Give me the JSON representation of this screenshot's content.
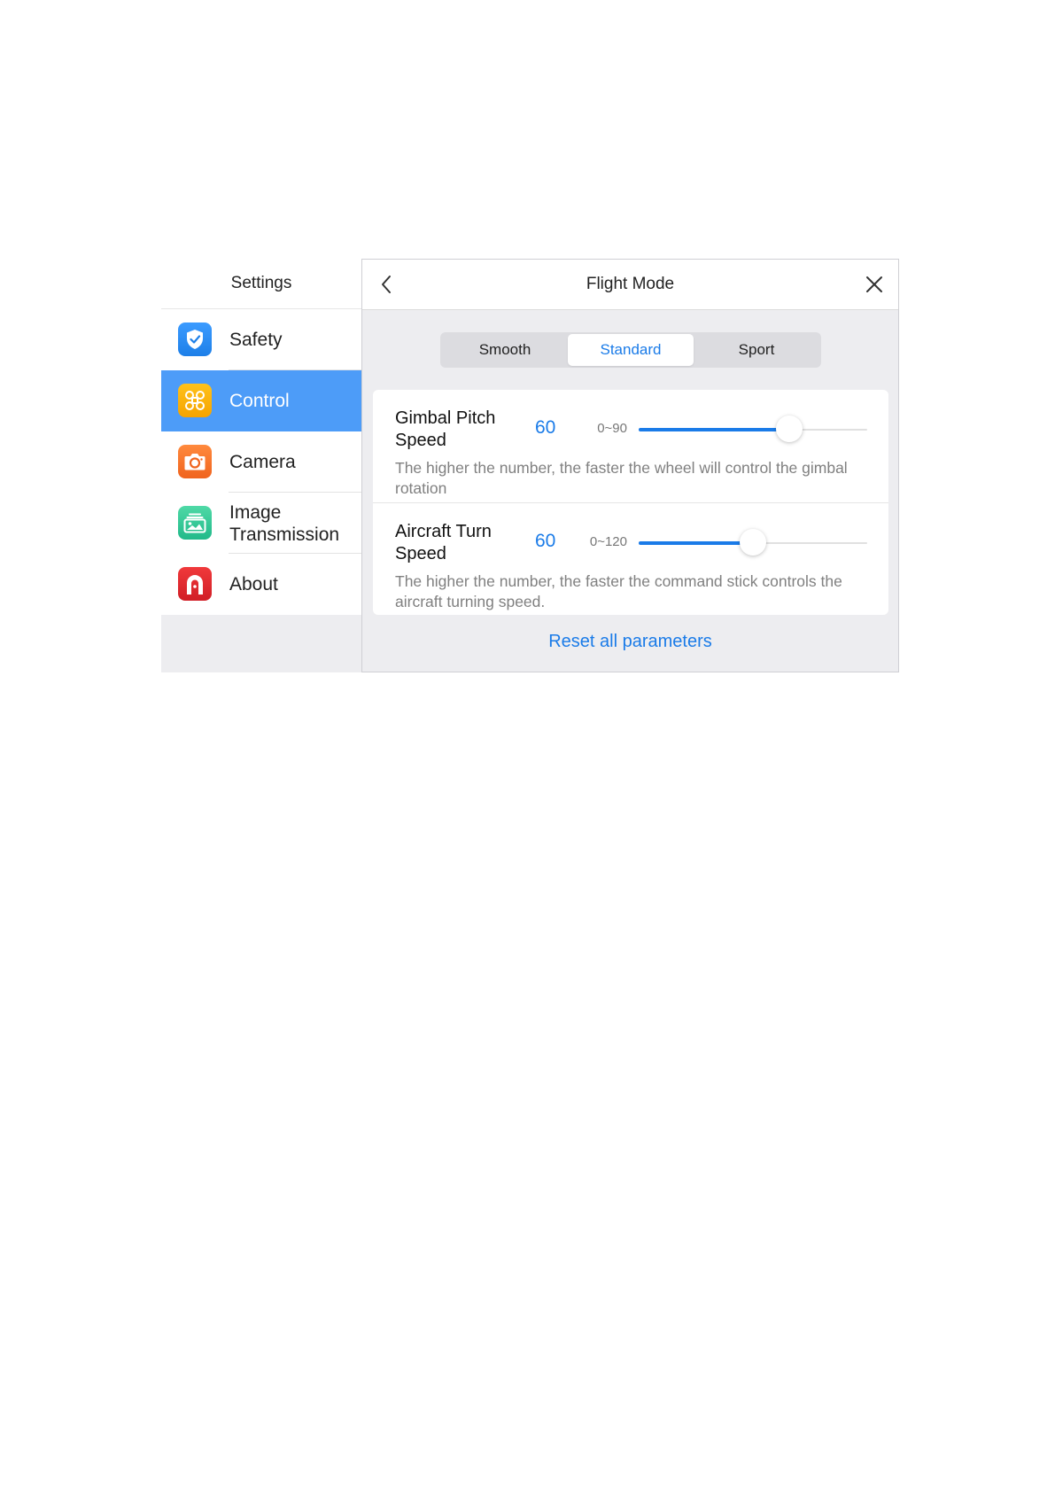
{
  "sidebar": {
    "title": "Settings",
    "items": [
      {
        "label": "Safety",
        "icon": "shield-check-icon",
        "selected": false
      },
      {
        "label": "Control",
        "icon": "drone-icon",
        "selected": true
      },
      {
        "label": "Camera",
        "icon": "camera-icon",
        "selected": false
      },
      {
        "label": "Image Transmission",
        "icon": "image-icon",
        "selected": false
      },
      {
        "label": "About",
        "icon": "about-logo-icon",
        "selected": false
      }
    ]
  },
  "panel": {
    "title": "Flight Mode",
    "back_icon": "chevron-left-icon",
    "close_icon": "close-icon",
    "modes": [
      {
        "label": "Smooth",
        "active": false
      },
      {
        "label": "Standard",
        "active": true
      },
      {
        "label": "Sport",
        "active": false
      }
    ],
    "settings": [
      {
        "name": "Gimbal Pitch Speed",
        "value": "60",
        "range": "0~90",
        "slider_level": 0.66,
        "description": "The higher the number, the faster the wheel will control the gimbal rotation"
      },
      {
        "name": "Aircraft Turn Speed",
        "value": "60",
        "range": "0~120",
        "slider_level": 0.5,
        "description": "The higher the number, the faster the command stick controls the aircraft turning speed."
      }
    ],
    "reset_label": "Reset all parameters"
  },
  "colors": {
    "accent": "#1a7be8",
    "selected_row": "#4d9cf8",
    "panel_background": "#ededf0"
  }
}
